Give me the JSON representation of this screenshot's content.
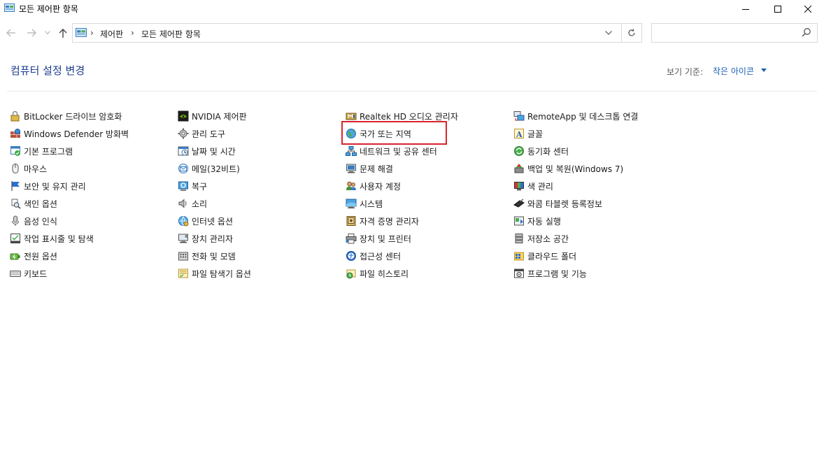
{
  "window": {
    "title": "모든 제어판 항목"
  },
  "nav": {
    "breadcrumbs": [
      "제어판",
      "모든 제어판 항목"
    ],
    "search_placeholder": ""
  },
  "header": {
    "title": "컴퓨터 설정 변경",
    "view_by_label": "보기 기준:",
    "view_by_value": "작은 아이콘"
  },
  "columns": [
    [
      {
        "label": "BitLocker 드라이브 암호화",
        "icon": "bitlocker-icon"
      },
      {
        "label": "Windows Defender 방화벽",
        "icon": "firewall-icon"
      },
      {
        "label": "기본 프로그램",
        "icon": "default-programs-icon"
      },
      {
        "label": "마우스",
        "icon": "mouse-icon"
      },
      {
        "label": "보안 및 유지 관리",
        "icon": "flag-icon"
      },
      {
        "label": "색인 옵션",
        "icon": "indexing-icon"
      },
      {
        "label": "음성 인식",
        "icon": "microphone-icon"
      },
      {
        "label": "작업 표시줄 및 탐색",
        "icon": "taskbar-icon"
      },
      {
        "label": "전원 옵션",
        "icon": "power-icon"
      },
      {
        "label": "키보드",
        "icon": "keyboard-icon"
      }
    ],
    [
      {
        "label": "NVIDIA 제어판",
        "icon": "nvidia-icon"
      },
      {
        "label": "관리 도구",
        "icon": "admin-tools-icon"
      },
      {
        "label": "날짜 및 시간",
        "icon": "clock-icon"
      },
      {
        "label": "메일(32비트)",
        "icon": "mail-icon"
      },
      {
        "label": "복구",
        "icon": "recovery-icon"
      },
      {
        "label": "소리",
        "icon": "speaker-icon"
      },
      {
        "label": "인터넷 옵션",
        "icon": "internet-options-icon"
      },
      {
        "label": "장치 관리자",
        "icon": "device-manager-icon"
      },
      {
        "label": "전화 및 모뎀",
        "icon": "phone-modem-icon"
      },
      {
        "label": "파일 탐색기 옵션",
        "icon": "folder-options-icon"
      }
    ],
    [
      {
        "label": "Realtek HD 오디오 관리자",
        "icon": "realtek-audio-icon"
      },
      {
        "label": "국가 또는 지역",
        "icon": "region-globe-icon"
      },
      {
        "label": "네트워크 및 공유 센터",
        "icon": "network-icon"
      },
      {
        "label": "문제 해결",
        "icon": "troubleshoot-icon"
      },
      {
        "label": "사용자 계정",
        "icon": "user-accounts-icon"
      },
      {
        "label": "시스템",
        "icon": "system-icon"
      },
      {
        "label": "자격 증명 관리자",
        "icon": "credential-icon"
      },
      {
        "label": "장치 및 프린터",
        "icon": "printer-icon"
      },
      {
        "label": "접근성 센터",
        "icon": "ease-of-access-icon"
      },
      {
        "label": "파일 히스토리",
        "icon": "file-history-icon"
      }
    ],
    [
      {
        "label": "RemoteApp 및 데스크톱 연결",
        "icon": "remoteapp-icon"
      },
      {
        "label": "글꼴",
        "icon": "fonts-icon"
      },
      {
        "label": "동기화 센터",
        "icon": "sync-icon"
      },
      {
        "label": "백업 및 복원(Windows 7)",
        "icon": "backup-icon"
      },
      {
        "label": "색 관리",
        "icon": "color-management-icon"
      },
      {
        "label": "와콤 타블렛 등록정보",
        "icon": "pen-tablet-icon"
      },
      {
        "label": "자동 실행",
        "icon": "autoplay-icon"
      },
      {
        "label": "저장소 공간",
        "icon": "storage-icon"
      },
      {
        "label": "클라우드 폴더",
        "icon": "cloud-folder-icon"
      },
      {
        "label": "프로그램 및 기능",
        "icon": "programs-icon"
      }
    ]
  ],
  "colors": {
    "title_blue": "#1e3d8f",
    "link_blue": "#1a5fb4",
    "highlight_red": "#d9232e"
  }
}
